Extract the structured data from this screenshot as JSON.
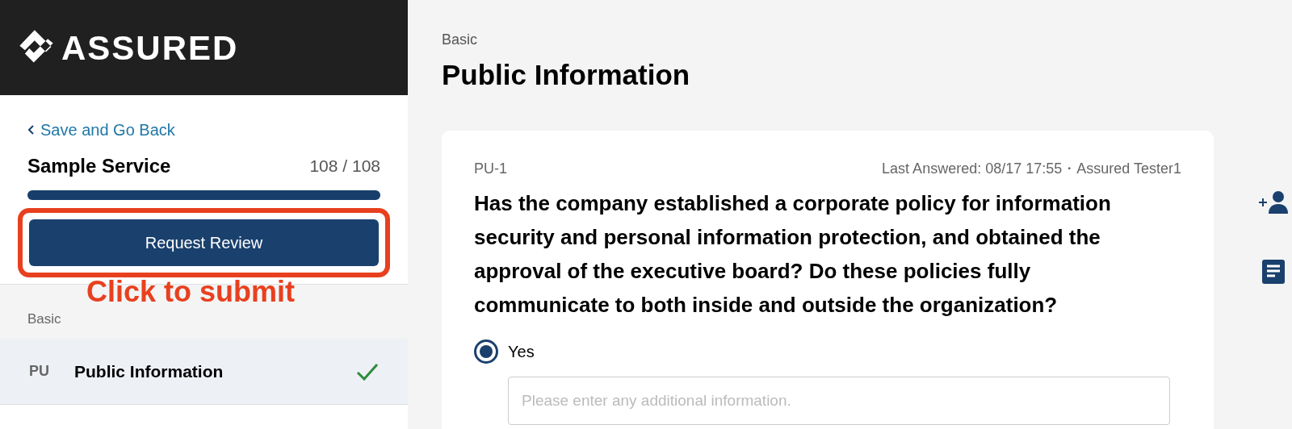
{
  "logo": {
    "text": "ASSURED"
  },
  "sidebar": {
    "back_link": "Save and Go Back",
    "service": {
      "name": "Sample Service",
      "progress": "108 / 108",
      "level": 1
    },
    "request_button": "Request Review",
    "section": "Basic",
    "items": [
      {
        "code": "PU",
        "label": "Public Information",
        "selected": true,
        "checked": true
      }
    ]
  },
  "annotation": {
    "text": "Click to submit",
    "highlight": true
  },
  "main": {
    "breadcrumb": "Basic",
    "title": "Public Information",
    "question": {
      "id": "PU-1",
      "meta": "Last Answered: 08/17 17:55・Assured Tester1",
      "text": "Has the company established a corporate policy for information security and personal information protection, and obtained the approval of the executive board? Do these policies fully communicate to both inside and outside the organization?",
      "options": [
        {
          "label": "Yes",
          "selected": true
        }
      ],
      "details": {
        "placeholder": "Please enter any additional information."
      }
    }
  }
}
